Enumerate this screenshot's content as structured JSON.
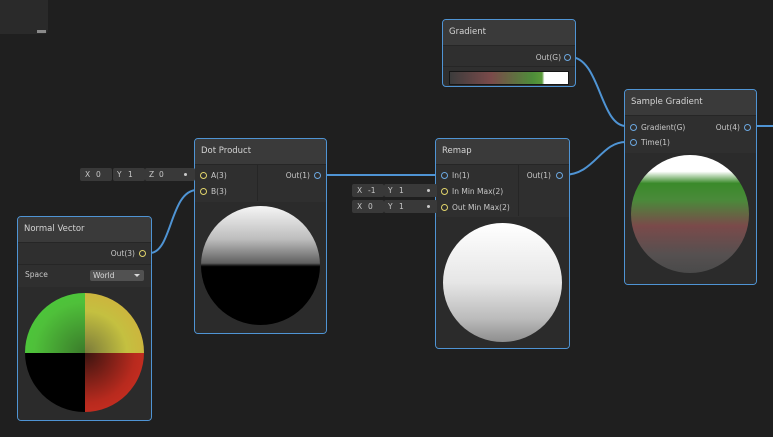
{
  "nodes": {
    "gradient": {
      "title": "Gradient",
      "output": "Out(G)"
    },
    "sample_gradient": {
      "title": "Sample Gradient",
      "inputs": [
        "Gradient(G)",
        "Time(1)"
      ],
      "output": "Out(4)"
    },
    "dot_product": {
      "title": "Dot Product",
      "inputs": [
        "A(3)",
        "B(3)"
      ],
      "output": "Out(1)"
    },
    "remap": {
      "title": "Remap",
      "inputs": [
        "In(1)",
        "In Min Max(2)",
        "Out Min Max(2)"
      ],
      "output": "Out(1)"
    },
    "normal_vector": {
      "title": "Normal Vector",
      "output": "Out(3)",
      "space_label": "Space",
      "space_value": "World"
    }
  },
  "inline_inputs": {
    "dot_a": {
      "x_label": "X",
      "x_value": "0",
      "y_label": "Y",
      "y_value": "1",
      "z_label": "Z",
      "z_value": "0"
    },
    "remap_in_min_max": {
      "x_label": "X",
      "x_value": "-1",
      "y_label": "Y",
      "y_value": "1"
    },
    "remap_out_min_max": {
      "x_label": "X",
      "x_value": "0",
      "y_label": "Y",
      "y_value": "1"
    }
  },
  "colors": {
    "wire": "#4f94d4",
    "node_border": "#4f94d4",
    "port_vector": "#e0d36b",
    "port_scalar": "#6ba7e0"
  },
  "gradient_colors": [
    "#3c3c3c",
    "#7a4a4a",
    "#4e8c3a",
    "#ffffff"
  ]
}
